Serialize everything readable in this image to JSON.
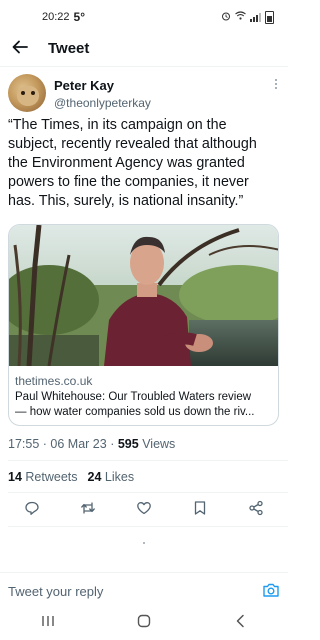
{
  "status_bar": {
    "time": "20:22",
    "temperature": "5°",
    "icons": [
      "alarm-icon",
      "wifi-icon",
      "signal-icon",
      "battery-icon"
    ]
  },
  "header": {
    "back_icon": "arrow-left-icon",
    "title": "Tweet"
  },
  "tweet": {
    "author": {
      "name": "Peter Kay",
      "handle": "@theonlypeterkay",
      "avatar": "dog-avatar"
    },
    "text": "“The Times, in its campaign on the subject, recently revealed that although the Environment Agency was granted powers to fine the companies, it never has. This, surely, is national insanity.”",
    "card": {
      "image": "man-by-river-photo",
      "domain": "thetimes.co.uk",
      "title_line1": "Paul Whitehouse: Our Troubled Waters review",
      "title_line2": "— how water companies sold us down the riv..."
    },
    "time": "17:55",
    "date": "06 Mar 23",
    "separator": "·",
    "views_count": "595",
    "views_label": "Views",
    "retweets_count": "14",
    "retweets_label": "Retweets",
    "likes_count": "24",
    "likes_label": "Likes",
    "actions": [
      "reply-icon",
      "retweet-icon",
      "like-icon",
      "bookmark-icon",
      "share-icon"
    ]
  },
  "reply": {
    "placeholder": "Tweet your reply"
  },
  "colors": {
    "accent": "#1d9bf0",
    "text": "#0f1419",
    "muted": "#536471",
    "divider": "#eff3f4"
  }
}
